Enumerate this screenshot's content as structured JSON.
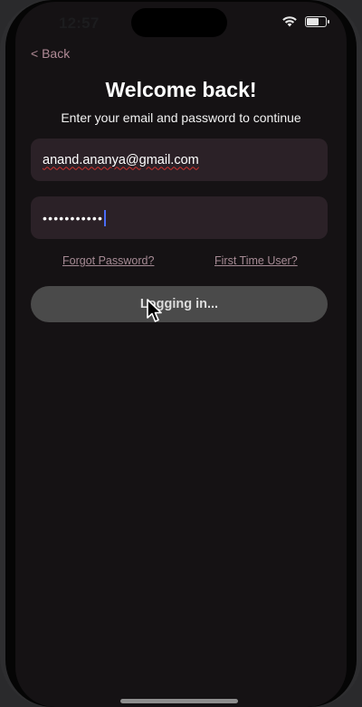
{
  "status_bar": {
    "time": "12:57",
    "wifi_icon": "wifi-icon",
    "battery_icon": "battery-icon",
    "battery_level": 0.7
  },
  "nav": {
    "back_label": "< Back"
  },
  "header": {
    "title": "Welcome back!",
    "subtitle": "Enter your email and password to continue"
  },
  "form": {
    "email_value": "anand.ananya@gmail.com",
    "password_masked": "•••••••••••"
  },
  "links": {
    "forgot_password": "Forgot Password?",
    "first_time_user": "First Time User?"
  },
  "actions": {
    "login_label": "Logging in..."
  },
  "colors": {
    "screen_background": "#151214",
    "field_background": "#2b2127",
    "accent_link": "#b08a96",
    "button_background": "#4a4a4a",
    "caret": "#4a6cf7"
  }
}
